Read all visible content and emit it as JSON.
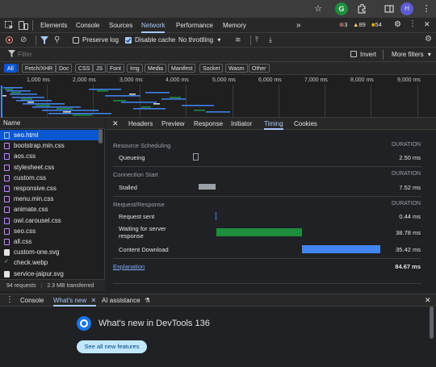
{
  "browser": {
    "star_icon": "☆",
    "ext_letter": "G",
    "profile_letter": "H"
  },
  "devtools": {
    "tabs": [
      "Elements",
      "Console",
      "Sources",
      "Network",
      "Performance",
      "Memory"
    ],
    "more_tabs": "»",
    "errors": "3",
    "warnings": "89",
    "issues": "54",
    "accent": "#a8c7fa"
  },
  "toolbar": {
    "preserve_log": "Preserve log",
    "disable_cache": "Disable cache",
    "throttling": "No throttling"
  },
  "filter": {
    "placeholder": "Filter",
    "invert": "Invert",
    "more_filters": "More filters"
  },
  "types": [
    "All",
    "Fetch/XHR",
    "Doc",
    "CSS",
    "JS",
    "Font",
    "Img",
    "Media",
    "Manifest",
    "Socket",
    "Wasm",
    "Other"
  ],
  "overview": {
    "ticks": [
      "1,000 ms",
      "2,000 ms",
      "3,000 ms",
      "4,000 ms",
      "5,000 ms",
      "6,000 ms",
      "7,000 ms",
      "8,000 ms",
      "9,000 ms"
    ]
  },
  "requests": {
    "header": "Name",
    "items": [
      {
        "name": "seo.html",
        "type": "doc"
      },
      {
        "name": "bootstrap.min.css",
        "type": "css"
      },
      {
        "name": "aos.css",
        "type": "css"
      },
      {
        "name": "stylesheet.css",
        "type": "css"
      },
      {
        "name": "custom.css",
        "type": "css"
      },
      {
        "name": "responsive.css",
        "type": "css"
      },
      {
        "name": "menu.min.css",
        "type": "css"
      },
      {
        "name": "animate.css",
        "type": "css"
      },
      {
        "name": "owl.carousel.css",
        "type": "css"
      },
      {
        "name": "seo.css",
        "type": "css"
      },
      {
        "name": "all.css",
        "type": "css"
      },
      {
        "name": "custom-one.svg",
        "type": "img"
      },
      {
        "name": "check.webp",
        "type": "webp"
      },
      {
        "name": "service-jaipur.svg",
        "type": "img"
      }
    ],
    "count": "94 requests",
    "transferred": "2.3 MB transferred"
  },
  "details": {
    "close_icon": "✕",
    "tabs": [
      "Headers",
      "Preview",
      "Response",
      "Initiator",
      "Timing",
      "Cookies"
    ],
    "active_tab": "Timing"
  },
  "timing": {
    "duration_label": "DURATION",
    "resource_scheduling": "Resource Scheduling",
    "queueing_label": "Queueing",
    "queueing_value": "2.50 ms",
    "connection_start": "Connection Start",
    "stalled_label": "Stalled",
    "stalled_value": "7.52 ms",
    "request_response": "Request/Response",
    "request_sent_label": "Request sent",
    "request_sent_value": "0.44 ms",
    "waiting_label": "Waiting for server response",
    "waiting_value": "38.78 ms",
    "download_label": "Content Download",
    "download_value": "35.42 ms",
    "explanation": "Explanation",
    "total": "84.67 ms",
    "waiting_color": "#1e8e3e",
    "download_color": "#4285f4"
  },
  "drawer": {
    "tabs": [
      "Console",
      "What's new",
      "AI assistance"
    ],
    "title": "What's new in DevTools 136",
    "button": "See all new features"
  }
}
